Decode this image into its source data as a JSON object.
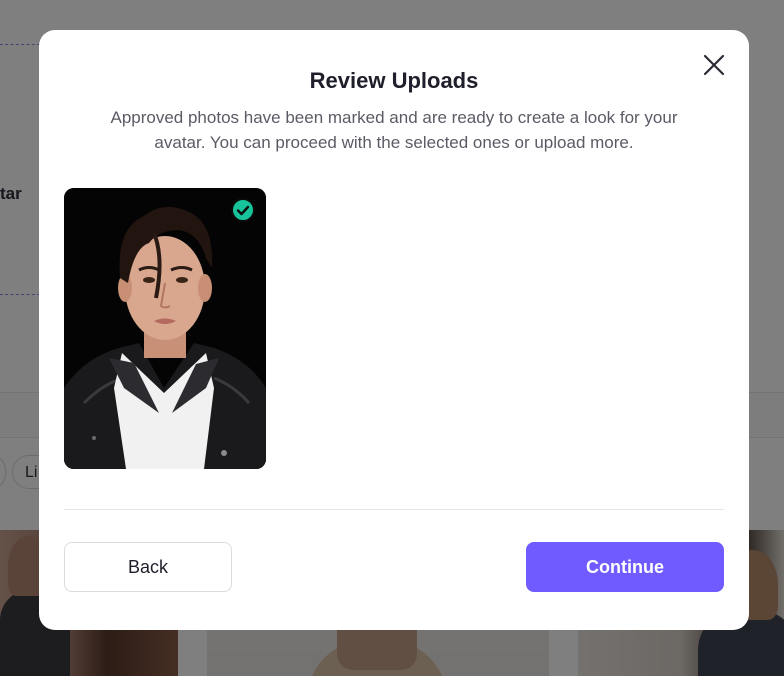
{
  "background": {
    "partial_label": "tar",
    "chip_partial": "Li"
  },
  "modal": {
    "title": "Review Uploads",
    "description": "Approved photos have been marked and are ready to create a look for your avatar. You can proceed with the selected ones or upload more.",
    "photos": [
      {
        "status": "approved",
        "badge_icon": "check-circle-icon"
      }
    ],
    "back_label": "Back",
    "continue_label": "Continue",
    "close_icon": "close-icon"
  },
  "colors": {
    "accent": "#6f5bff",
    "approved_badge": "#17c39a",
    "title_text": "#1f1f2b",
    "body_text": "#5b5b66"
  }
}
